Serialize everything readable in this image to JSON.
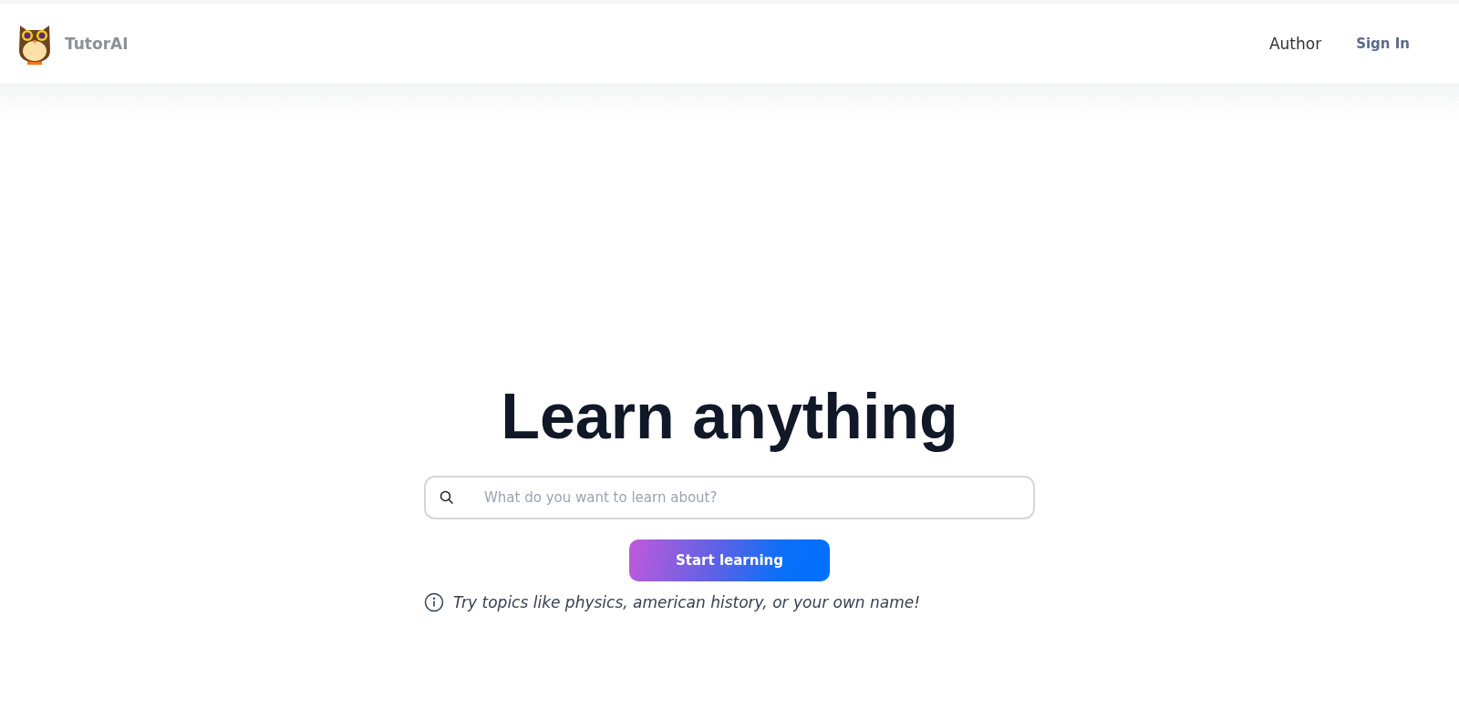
{
  "header": {
    "brand": "TutorAI",
    "nav": [
      "Author",
      "Sign In"
    ]
  },
  "hero": {
    "title": "Learn anything",
    "search": {
      "placeholder": "What do you want to learn about?"
    },
    "button": "Start learning",
    "hint": "Try topics like physics, american history, or your own name!"
  }
}
